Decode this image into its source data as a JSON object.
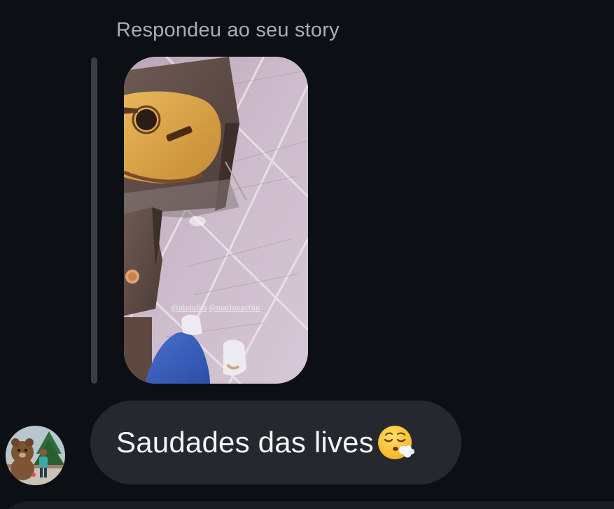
{
  "conversation": {
    "reply_label": "Respondeu ao seu story",
    "story": {
      "mentions": [
        "@abdufps",
        "@mathmartiin"
      ]
    },
    "message": {
      "text": "Saudades das lives",
      "emoji": "face-exhaling-emoji"
    },
    "sender_avatar": "avatar-photo"
  },
  "colors": {
    "background": "#0c0f14",
    "bubble": "#25282e",
    "label_text": "#a9adb5",
    "message_text": "#f4f5f7",
    "quote_bar": "#3a3d43"
  }
}
